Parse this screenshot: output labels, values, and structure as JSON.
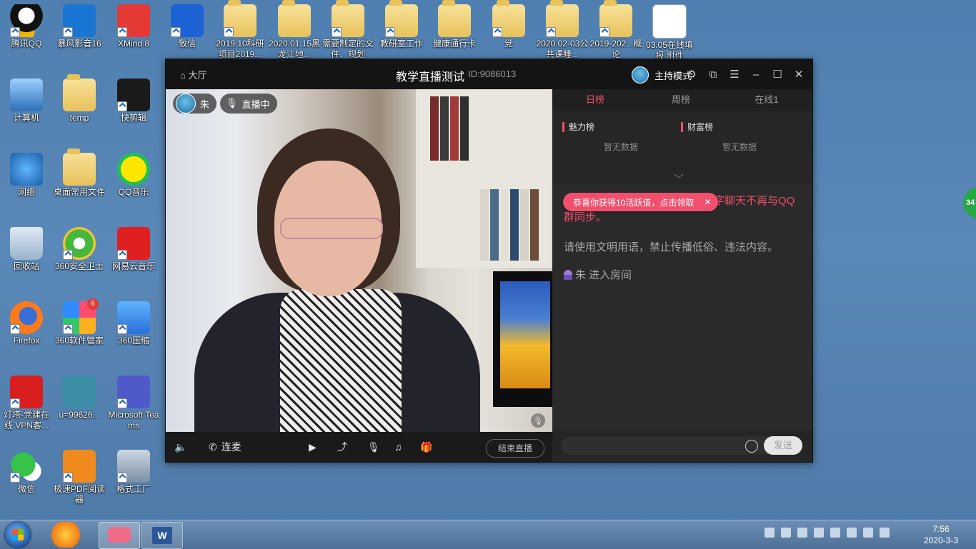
{
  "desktop": {
    "icons": [
      {
        "label": "腾讯QQ"
      },
      {
        "label": "暴风影音16"
      },
      {
        "label": "XMind 8"
      },
      {
        "label": "致信"
      },
      {
        "label": "2019.10科研项目2019..."
      },
      {
        "label": "2020.01.15黑龙江地..."
      },
      {
        "label": "需要制定的文件、规划"
      },
      {
        "label": "教研室工作"
      },
      {
        "label": "健康通行卡"
      },
      {
        "label": "党"
      },
      {
        "label": "2020.02-03公共课睡..."
      },
      {
        "label": "2019-202...概论"
      },
      {
        "label": "03.05在线填报 附件"
      },
      {
        "label": "计算机"
      },
      {
        "label": "temp"
      },
      {
        "label": "快剪辑"
      },
      {
        "label": "网络"
      },
      {
        "label": "桌面常用文件"
      },
      {
        "label": "QQ音乐"
      },
      {
        "label": "回收站"
      },
      {
        "label": "360安全卫士"
      },
      {
        "label": "网易云音乐"
      },
      {
        "label": "Firefox"
      },
      {
        "label": "360软件管家"
      },
      {
        "label": "360压缩"
      },
      {
        "label": "灯塔-党建在线 VPN客..."
      },
      {
        "label": "u=99626..."
      },
      {
        "label": "Microsoft Teams"
      },
      {
        "label": "微信"
      },
      {
        "label": "极速PDF阅读器"
      },
      {
        "label": "格式工厂"
      }
    ],
    "badge_360": "6",
    "side_ball": "34"
  },
  "window": {
    "hall_label": "大厅",
    "title": "教学直播测试",
    "room_id": "ID:9086013",
    "mode_label": "主持模式"
  },
  "video": {
    "host_name": "朱",
    "live_label": "直播中"
  },
  "controls": {
    "connect_label": "连麦",
    "end_label": "结束直播"
  },
  "side": {
    "tabs": [
      "日榜",
      "周榜",
      "在线1"
    ],
    "charm_title": "魅力榜",
    "wealth_title": "财富榜",
    "empty_text": "暂无数据",
    "toast": "恭喜你获得10活跃值，点击领取",
    "notice": "为了保障信息安全，视频房间文字聊天不再与QQ群同步。",
    "rules": "请使用文明用语，禁止传播低俗、违法内容。",
    "enter_user": "朱",
    "enter_text": "进入房间",
    "send_label": "发送",
    "input_placeholder": ""
  },
  "taskbar": {
    "time": "7:56",
    "date": "2020-3-3"
  },
  "colors": {
    "accent": "#f0506e",
    "window_bg": "#1e1e1e",
    "desktop": "#5a88b8"
  }
}
